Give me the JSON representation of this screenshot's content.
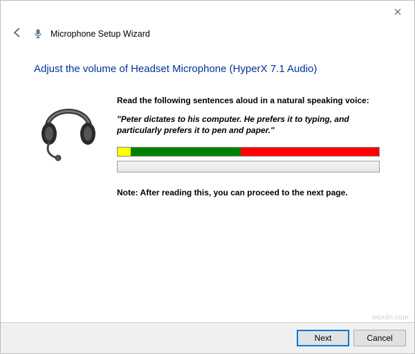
{
  "window": {
    "title": "Microphone Setup Wizard"
  },
  "page": {
    "heading": "Adjust the volume of Headset Microphone (HyperX 7.1 Audio)",
    "instruction_label": "Read the following sentences aloud in a natural speaking voice:",
    "quote_text": "\"Peter dictates to his computer. He prefers it to typing, and particularly prefers it to pen and paper.\"",
    "note_text": "Note: After reading this, you can proceed to the next page."
  },
  "level_meter": {
    "segments": [
      {
        "color": "yellow",
        "flex": 5
      },
      {
        "color": "green",
        "flex": 42
      },
      {
        "color": "red",
        "flex": 53
      }
    ]
  },
  "progress": {
    "value_pct": 0
  },
  "buttons": {
    "next": "Next",
    "cancel": "Cancel"
  },
  "icons": {
    "back": "back-arrow-icon",
    "close": "close-icon",
    "microphone": "microphone-icon",
    "headset": "headset-icon"
  },
  "colors": {
    "heading": "#003399",
    "primary_border": "#0078d7"
  },
  "watermark": "wsxdn.com"
}
